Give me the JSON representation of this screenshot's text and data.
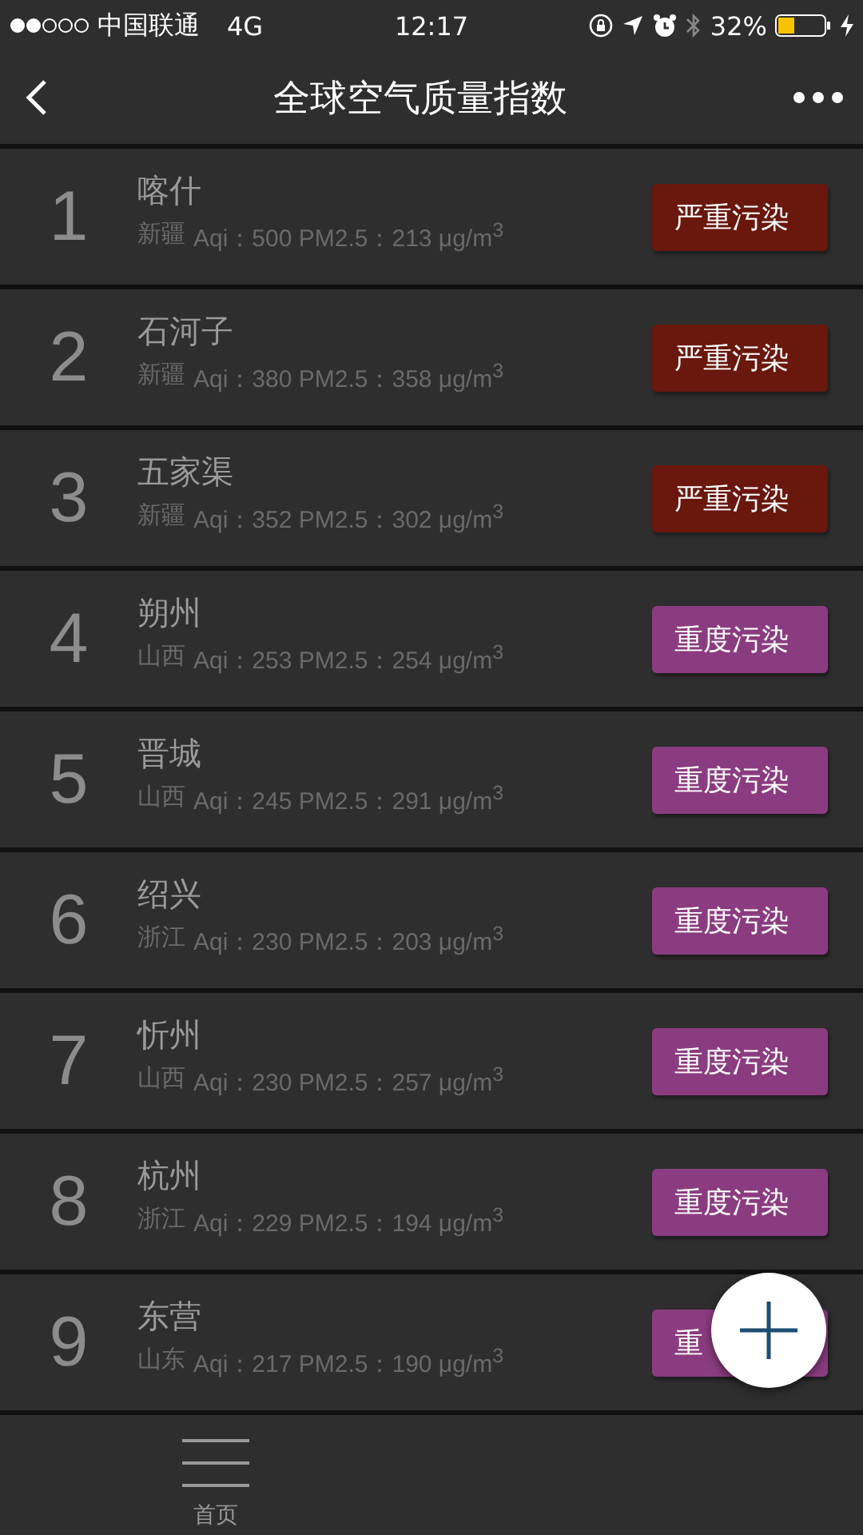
{
  "status_bar": {
    "carrier": "中国联通",
    "network": "4G",
    "time": "12:17",
    "battery": "32%"
  },
  "nav": {
    "title": "全球空气质量指数"
  },
  "rows": [
    {
      "rank": "1",
      "city": "喀什",
      "province": "新疆",
      "detail": "Aqi：500 PM2.5：213 μg/m$^{3}$",
      "badge": "严重污染",
      "color": "#6a170e"
    },
    {
      "rank": "2",
      "city": "石河子",
      "province": "新疆",
      "detail": "Aqi：380 PM2.5：358 μg/m$^{3}$",
      "badge": "严重污染",
      "color": "#6a170e"
    },
    {
      "rank": "3",
      "city": "五家渠",
      "province": "新疆",
      "detail": "Aqi：352 PM2.5：302 μg/m$^{3}$",
      "badge": "严重污染",
      "color": "#6a170e"
    },
    {
      "rank": "4",
      "city": "朔州",
      "province": "山西",
      "detail": "Aqi：253 PM2.5：254 μg/m$^{3}$",
      "badge": "重度污染",
      "color": "#8b3c80"
    },
    {
      "rank": "5",
      "city": "晋城",
      "province": "山西",
      "detail": "Aqi：245 PM2.5：291 μg/m$^{3}$",
      "badge": "重度污染",
      "color": "#8b3c80"
    },
    {
      "rank": "6",
      "city": "绍兴",
      "province": "浙江",
      "detail": "Aqi：230 PM2.5：203 μg/m$^{3}$",
      "badge": "重度污染",
      "color": "#8b3c80"
    },
    {
      "rank": "7",
      "city": "忻州",
      "province": "山西",
      "detail": "Aqi：230 PM2.5：257 μg/m$^{3}$",
      "badge": "重度污染",
      "color": "#8b3c80"
    },
    {
      "rank": "8",
      "city": "杭州",
      "province": "浙江",
      "detail": "Aqi：229 PM2.5：194 μg/m$^{3}$",
      "badge": "重度污染",
      "color": "#8b3c80"
    },
    {
      "rank": "9",
      "city": "东营",
      "province": "山东",
      "detail": "Aqi：217 PM2.5：190 μg/m$^{3}$",
      "badge": "重",
      "color": "#8b3c80"
    }
  ],
  "tab_bar": {
    "items": [
      {
        "label": "首页"
      }
    ]
  }
}
